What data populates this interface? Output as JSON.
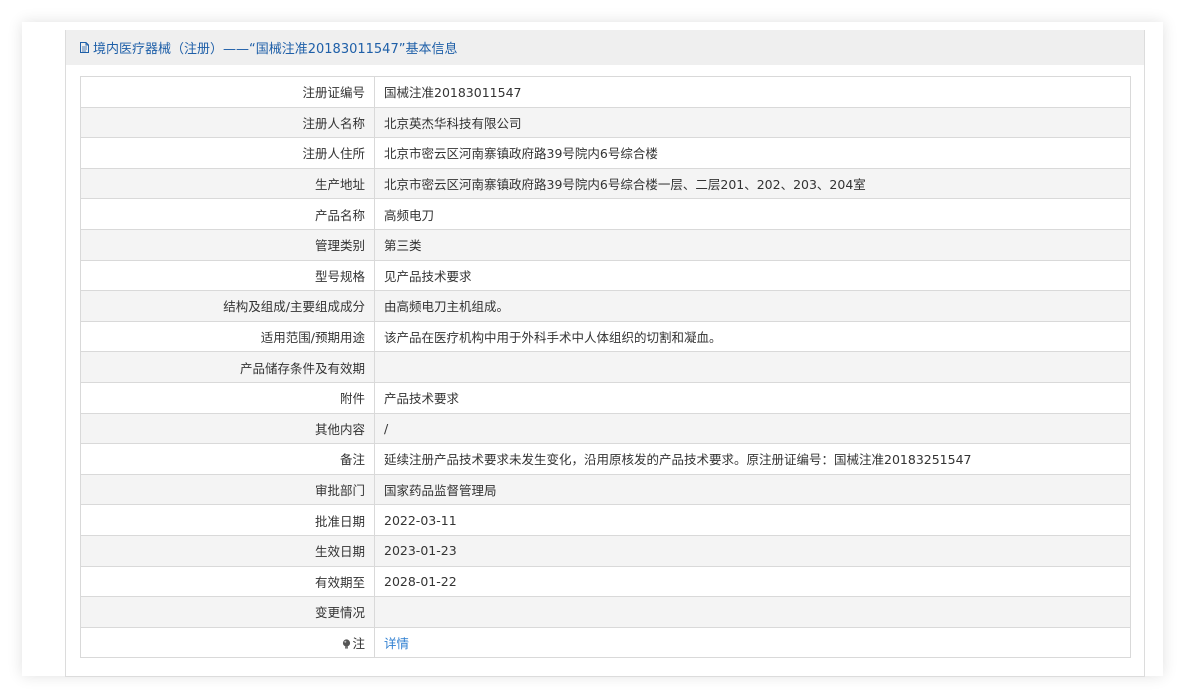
{
  "header": {
    "title": "境内医疗器械（注册）——“国械注准20183011547”基本信息",
    "icon": "document-icon"
  },
  "rows": [
    {
      "label": "注册证编号",
      "value": "国械注准20183011547"
    },
    {
      "label": "注册人名称",
      "value": "北京英杰华科技有限公司"
    },
    {
      "label": "注册人住所",
      "value": "北京市密云区河南寨镇政府路39号院内6号综合楼"
    },
    {
      "label": "生产地址",
      "value": "北京市密云区河南寨镇政府路39号院内6号综合楼一层、二层201、202、203、204室"
    },
    {
      "label": "产品名称",
      "value": "高频电刀"
    },
    {
      "label": "管理类别",
      "value": "第三类"
    },
    {
      "label": "型号规格",
      "value": "见产品技术要求"
    },
    {
      "label": "结构及组成/主要组成成分",
      "value": "由高频电刀主机组成。"
    },
    {
      "label": "适用范围/预期用途",
      "value": "该产品在医疗机构中用于外科手术中人体组织的切割和凝血。"
    },
    {
      "label": "产品储存条件及有效期",
      "value": ""
    },
    {
      "label": "附件",
      "value": "产品技术要求"
    },
    {
      "label": "其他内容",
      "value": "/"
    },
    {
      "label": "备注",
      "value": "延续注册产品技术要求未发生变化，沿用原核发的产品技术要求。原注册证编号：国械注准20183251547"
    },
    {
      "label": "审批部门",
      "value": "国家药品监督管理局"
    },
    {
      "label": "批准日期",
      "value": "2022-03-11"
    },
    {
      "label": "生效日期",
      "value": "2023-01-23"
    },
    {
      "label": "有效期至",
      "value": "2028-01-22"
    },
    {
      "label": "变更情况",
      "value": ""
    }
  ],
  "note_row": {
    "label": "注",
    "icon": "lightbulb-icon",
    "link": "详情"
  },
  "colors": {
    "header_bg": "#efefef",
    "header_text": "#1e5fa8",
    "row_alt_bg": "#f4f4f4",
    "link": "#2f7fd1"
  }
}
